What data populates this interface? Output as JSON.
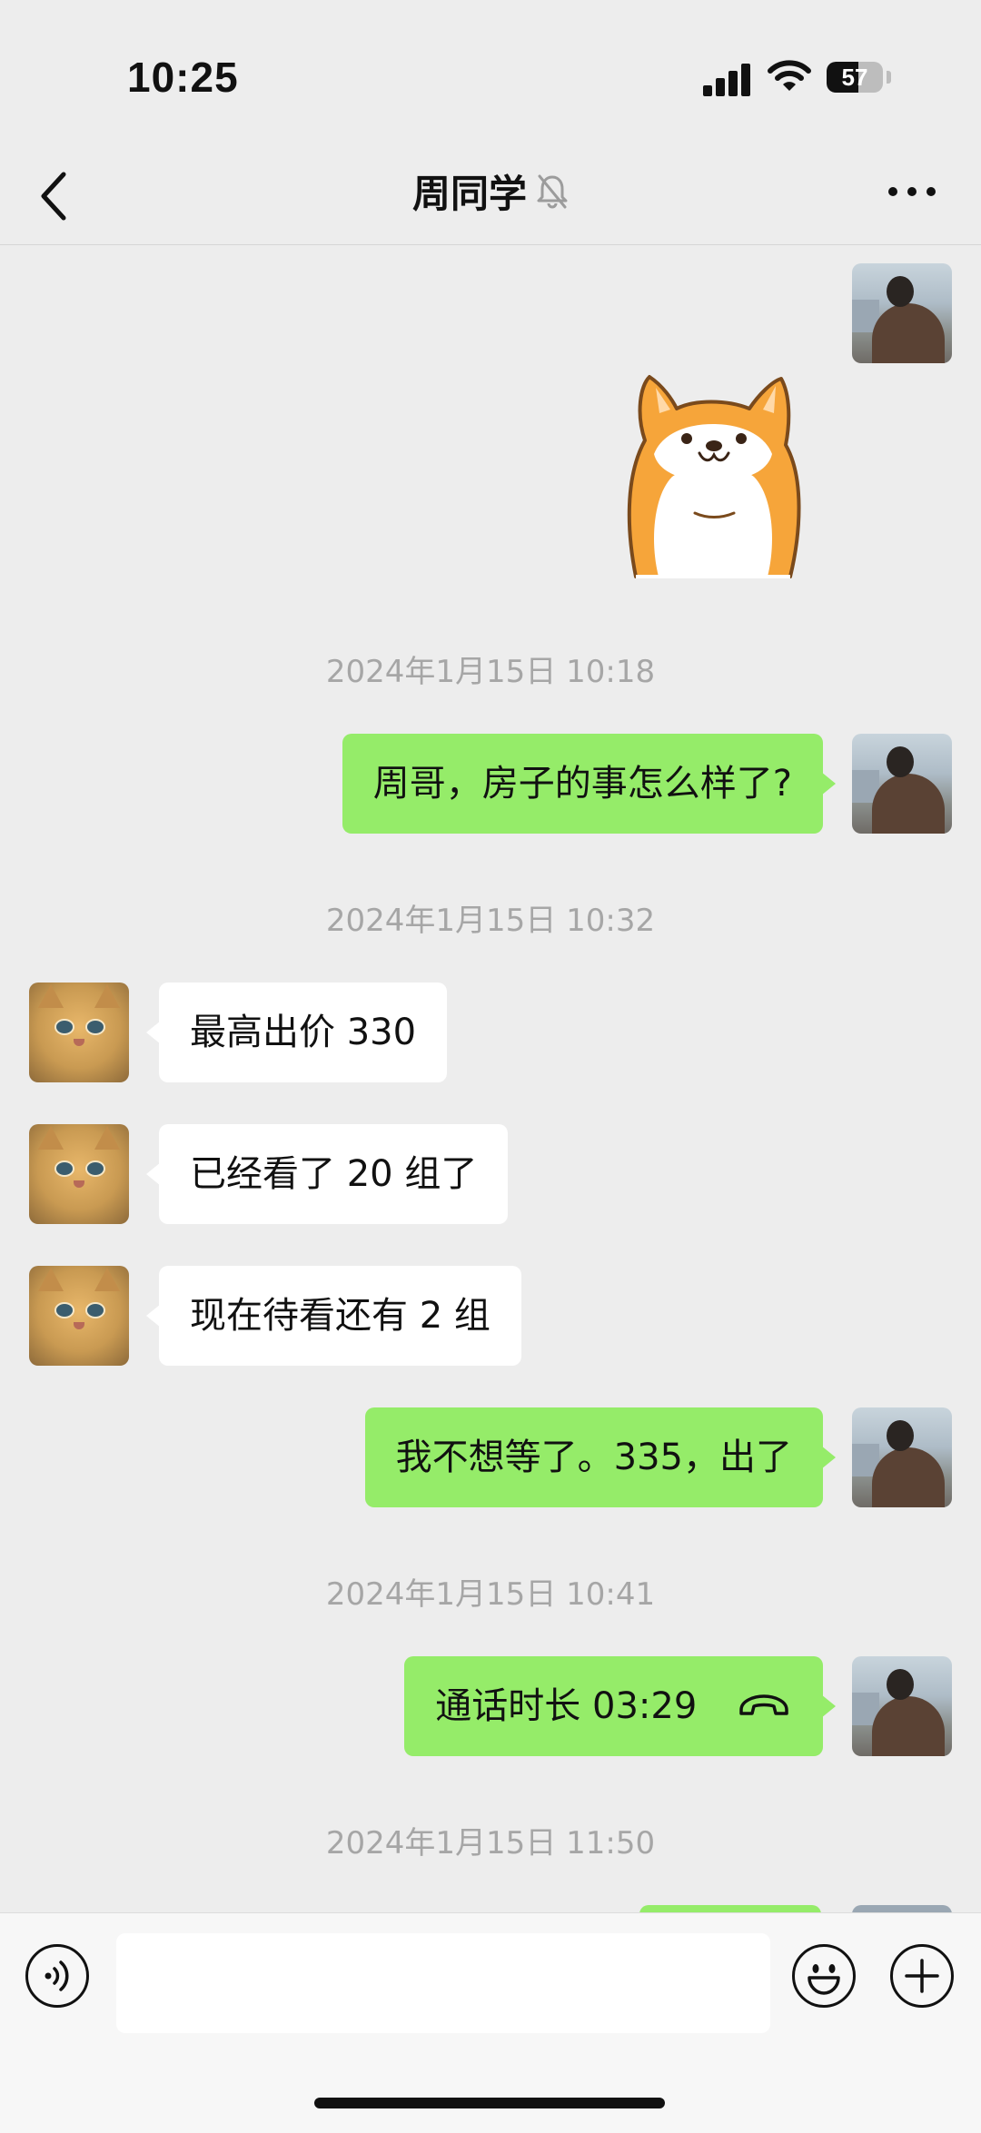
{
  "status_bar": {
    "time": "10:25",
    "battery": "57",
    "battery_level_percent": 57
  },
  "header": {
    "title": "周同学",
    "muted": true
  },
  "messages": [
    {
      "type": "sticker",
      "from": "me",
      "icon": "shiba-sticker"
    },
    {
      "type": "timestamp",
      "text": "2024年1月15日 10:18"
    },
    {
      "type": "text",
      "from": "me",
      "text": "周哥，房子的事怎么样了?"
    },
    {
      "type": "timestamp",
      "text": "2024年1月15日 10:32"
    },
    {
      "type": "text",
      "from": "them",
      "text": "最高出价 330"
    },
    {
      "type": "text",
      "from": "them",
      "text": "已经看了 20 组了"
    },
    {
      "type": "text",
      "from": "them",
      "text": "现在待看还有 2 组"
    },
    {
      "type": "text",
      "from": "me",
      "text": "我不想等了。335，出了"
    },
    {
      "type": "timestamp",
      "text": "2024年1月15日 10:41"
    },
    {
      "type": "call",
      "from": "me",
      "text": "通话时长 03:29",
      "icon": "phone-hangup-icon"
    },
    {
      "type": "timestamp",
      "text": "2024年1月15日 11:50"
    }
  ],
  "input_bar": {
    "voice_icon": "voice-icon",
    "emoji_icon": "emoji-icon",
    "plus_icon": "plus-icon",
    "placeholder": ""
  },
  "colors": {
    "my_bubble": "#95ec69",
    "their_bubble": "#ffffff",
    "background": "#ededed",
    "timestamp": "#a6a6a6"
  }
}
